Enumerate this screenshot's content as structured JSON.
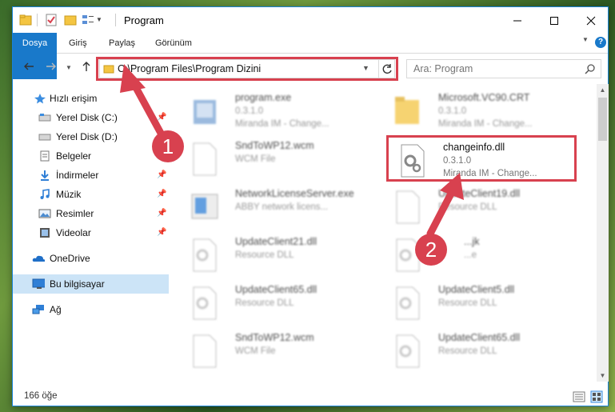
{
  "window": {
    "title": "Program",
    "min_icon": "minimize-icon",
    "max_icon": "maximize-icon",
    "close_icon": "close-icon"
  },
  "ribbon": {
    "tabs": [
      "Dosya",
      "Giriş",
      "Paylaş",
      "Görünüm"
    ],
    "help": "?"
  },
  "nav": {
    "address": "C:\\Program Files\\Program Dizini",
    "search_placeholder": "Ara: Program"
  },
  "sidebar": {
    "items": [
      {
        "label": "Hızlı erişim",
        "icon": "star-icon",
        "pinned": false
      },
      {
        "label": "Yerel Disk (C:)",
        "icon": "drive-icon",
        "pinned": true
      },
      {
        "label": "Yerel Disk (D:)",
        "icon": "drive-icon",
        "pinned": false
      },
      {
        "label": "Belgeler",
        "icon": "documents-icon",
        "pinned": true
      },
      {
        "label": "İndirmeler",
        "icon": "download-icon",
        "pinned": true
      },
      {
        "label": "Müzik",
        "icon": "music-icon",
        "pinned": true
      },
      {
        "label": "Resimler",
        "icon": "pictures-icon",
        "pinned": true
      },
      {
        "label": "Videolar",
        "icon": "video-icon",
        "pinned": true
      },
      {
        "label": "OneDrive",
        "icon": "onedrive-icon",
        "pinned": false
      },
      {
        "label": "Bu bilgisayar",
        "icon": "computer-icon",
        "pinned": false,
        "selected": true
      },
      {
        "label": "Ağ",
        "icon": "network-icon",
        "pinned": false
      }
    ],
    "pin_glyph": "📌"
  },
  "files": [
    {
      "name": "program.exe",
      "line2": "0.3.1.0",
      "line3": "Miranda IM - Change...",
      "icon": "exe-icon"
    },
    {
      "name": "Microsoft.VC90.CRT",
      "line2": "0.3.1.0",
      "line3": "Miranda IM - Change...",
      "icon": "folder-icon"
    },
    {
      "name": "SndToWP12.wcm",
      "line2": "WCM File",
      "line3": "",
      "icon": "file-icon"
    },
    {
      "name": "changeinfo.dll",
      "line2": "0.3.1.0",
      "line3": "Miranda IM - Change...",
      "icon": "dll-icon",
      "highlighted": true
    },
    {
      "name": "NetworkLicenseServer.exe",
      "line2": "ABBY network licens...",
      "line3": "",
      "icon": "exe-icon"
    },
    {
      "name": "UpdateClient19.dll",
      "line2": "Resource DLL",
      "line3": "",
      "icon": "dll-icon"
    },
    {
      "name": "UpdateClient21.dll",
      "line2": "Resource DLL",
      "line3": "",
      "icon": "dll-icon"
    },
    {
      "name": "...jk",
      "line2": "...e",
      "line3": "",
      "icon": "dll-icon"
    },
    {
      "name": "UpdateClient65.dll",
      "line2": "Resource DLL",
      "line3": "",
      "icon": "dll-icon"
    },
    {
      "name": "UpdateClient5.dll",
      "line2": "Resource DLL",
      "line3": "",
      "icon": "dll-icon"
    },
    {
      "name": "SndToWP12.wcm",
      "line2": "WCM File",
      "line3": "",
      "icon": "file-icon"
    },
    {
      "name": "UpdateClient65.dll",
      "line2": "Resource DLL",
      "line3": "",
      "icon": "dll-icon"
    }
  ],
  "status": {
    "count_text": "166 öğe"
  },
  "markers": {
    "step1": "1",
    "step2": "2"
  },
  "colors": {
    "accent": "#1979ca",
    "highlight": "#d8414f",
    "selection": "#cce4f7"
  }
}
